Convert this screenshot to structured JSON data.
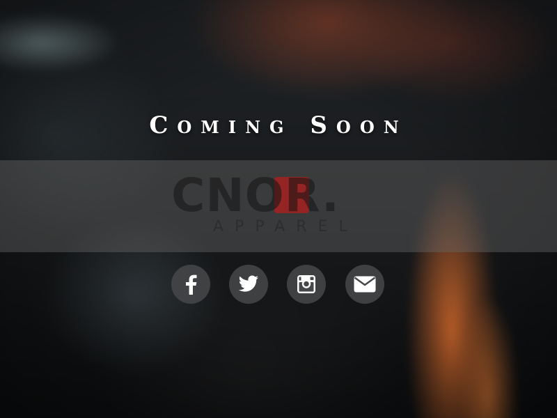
{
  "headline": "Coming Soon",
  "brand": {
    "name": "CNOR.",
    "tagline": "APPAREL",
    "accent_color": "#b41e1e"
  },
  "social": [
    {
      "name": "facebook",
      "icon": "facebook-icon"
    },
    {
      "name": "twitter",
      "icon": "twitter-icon"
    },
    {
      "name": "instagram",
      "icon": "instagram-icon"
    },
    {
      "name": "email",
      "icon": "envelope-icon"
    }
  ],
  "colors": {
    "band": "#696969",
    "button": "#46484a",
    "icon": "#ffffff"
  }
}
